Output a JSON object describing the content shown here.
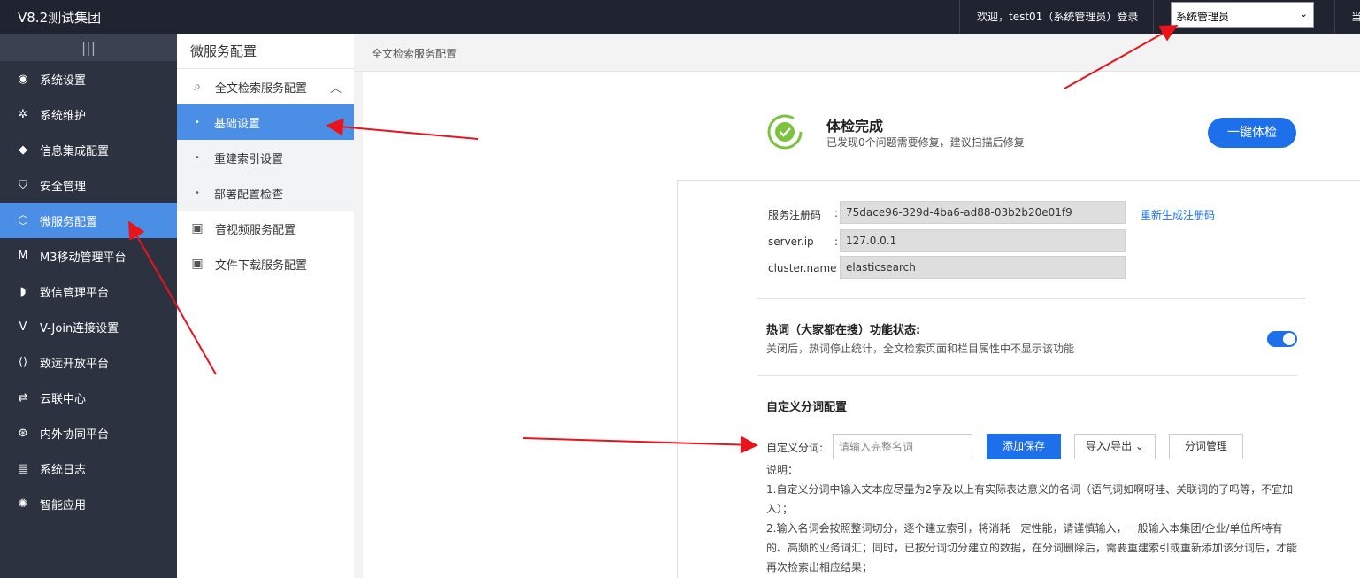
{
  "topbar": {
    "brand": "V8.2测试集团",
    "welcome": "欢迎，test01（系统管理员）登录",
    "role_selected": "系统管理员",
    "extra": "当"
  },
  "sidebar": {
    "collapse_glyph": "|||",
    "items": [
      {
        "label": "系统设置",
        "icon": "dashboard-icon",
        "glyph": "◉"
      },
      {
        "label": "系统维护",
        "icon": "gear-icon",
        "glyph": "✲"
      },
      {
        "label": "信息集成配置",
        "icon": "puzzle-icon",
        "glyph": "◆"
      },
      {
        "label": "安全管理",
        "icon": "shield-icon",
        "glyph": "⛉"
      },
      {
        "label": "微服务配置",
        "icon": "hexagon-icon",
        "glyph": "⬡"
      },
      {
        "label": "M3移动管理平台",
        "icon": "m3-logo-icon",
        "glyph": "M"
      },
      {
        "label": "致信管理平台",
        "icon": "chat-icon",
        "glyph": "◗"
      },
      {
        "label": "V-Join连接设置",
        "icon": "vjoin-icon",
        "glyph": "V"
      },
      {
        "label": "致远开放平台",
        "icon": "code-icon",
        "glyph": "⟨⟩"
      },
      {
        "label": "云联中心",
        "icon": "cloud-link-icon",
        "glyph": "⇄"
      },
      {
        "label": "内外协同平台",
        "icon": "collab-icon",
        "glyph": "⊛"
      },
      {
        "label": "系统日志",
        "icon": "log-icon",
        "glyph": "▤"
      },
      {
        "label": "智能应用",
        "icon": "bulb-icon",
        "glyph": "✺"
      }
    ]
  },
  "submenu": {
    "title": "微服务配置",
    "group": "全文检索服务配置",
    "children": [
      "基础设置",
      "重建索引设置",
      "部署配置检查"
    ],
    "others": [
      "音视频服务配置",
      "文件下载服务配置"
    ]
  },
  "breadcrumb": "全文检索服务配置",
  "health": {
    "title": "体检完成",
    "subtitle": "已发现0个问题需要修复，建议扫描后修复",
    "button": "一键体检"
  },
  "service": {
    "reg_code_label": "服务注册码",
    "reg_code": "75dace96-329d-4ba6-ad88-03b2b20e01f9",
    "regen_link": "重新生成注册码",
    "ip_label": "server.ip",
    "ip": "127.0.0.1",
    "cluster_label": "cluster.name",
    "cluster": "elasticsearch",
    "colon": ":"
  },
  "hotword": {
    "title": "热词（大家都在搜）功能状态:",
    "desc": "关闭后，热词停止统计，全文检索页面和栏目属性中不显示该功能",
    "enabled": true
  },
  "custom_words": {
    "title": "自定义分词配置",
    "label": "自定义分词:",
    "placeholder": "请输入完整名词",
    "save": "添加保存",
    "import_export": "导入/导出",
    "manage": "分词管理",
    "notes_title": "说明：",
    "note1": "1.自定义分词中输入文本应尽量为2字及以上有实际表达意义的名词（语气词如啊呀哇、关联词的了吗等，不宜加入）；",
    "note2": "2.输入名词会按照整词切分，逐个建立索引，将消耗一定性能，请谨慎输入，一般输入本集团/企业/单位所特有的、高频的业务词汇；同时，已按分词切分建立的数据，在分词删除后，需要重建索引或重新添加该分词后，才能再次检索出相应结果；"
  },
  "colors": {
    "accent": "#1e6fea",
    "sidebar_active": "#4a8ee6",
    "topbar": "#1f2430",
    "sidebar": "#2d3240",
    "annotation": "#e8141b"
  }
}
